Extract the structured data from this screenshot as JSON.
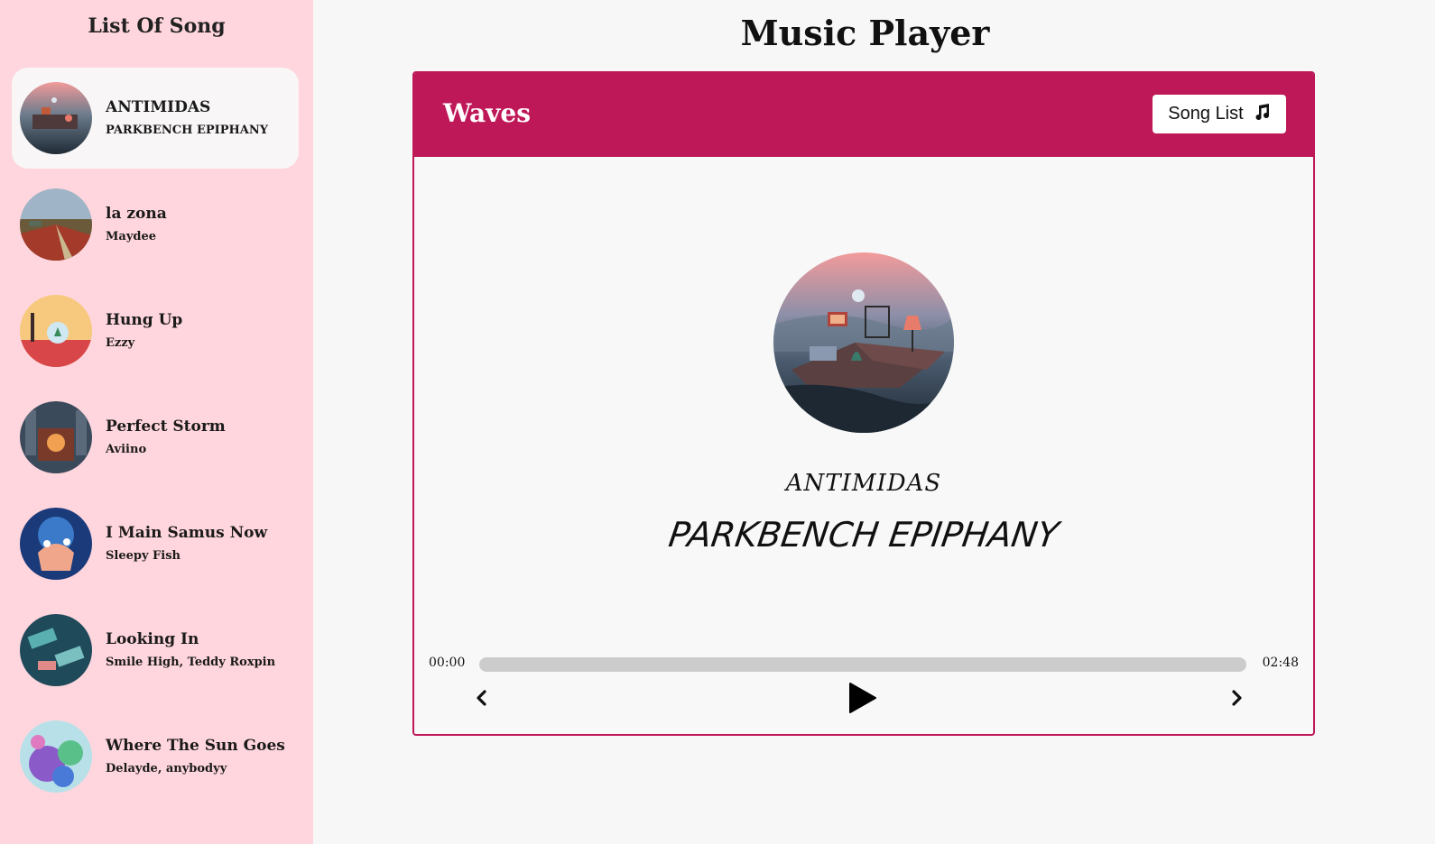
{
  "sidebar": {
    "title": "List Of Song",
    "songs": [
      {
        "title": "ANTIMIDAS",
        "artist": "PARKBENCH EPIPHANY",
        "active": true
      },
      {
        "title": "la zona",
        "artist": "Maydee",
        "active": false
      },
      {
        "title": "Hung Up",
        "artist": "Ezzy",
        "active": false
      },
      {
        "title": "Perfect Storm",
        "artist": "Aviino",
        "active": false
      },
      {
        "title": "I Main Samus Now",
        "artist": "Sleepy Fish",
        "active": false
      },
      {
        "title": "Looking In",
        "artist": "Smile High, Teddy Roxpin",
        "active": false
      },
      {
        "title": "Where The Sun Goes",
        "artist": "Delayde, anybodyy",
        "active": false
      }
    ]
  },
  "main": {
    "title": "Music Player"
  },
  "player": {
    "brand": "Waves",
    "song_list_button": "Song List",
    "now_playing": {
      "title": "ANTIMIDAS",
      "artist": "PARKBENCH EPIPHANY"
    },
    "time_current": "00:00",
    "time_total": "02:48",
    "progress": 0
  },
  "colors": {
    "accent": "#bf1858",
    "sidebar_bg": "#ffd6dd",
    "page_bg": "#f7f7f7",
    "track": "#cccccc"
  },
  "icons": {
    "song_list": "music-note-icon",
    "prev": "chevron-left-icon",
    "play": "play-icon",
    "next": "chevron-right-icon"
  }
}
